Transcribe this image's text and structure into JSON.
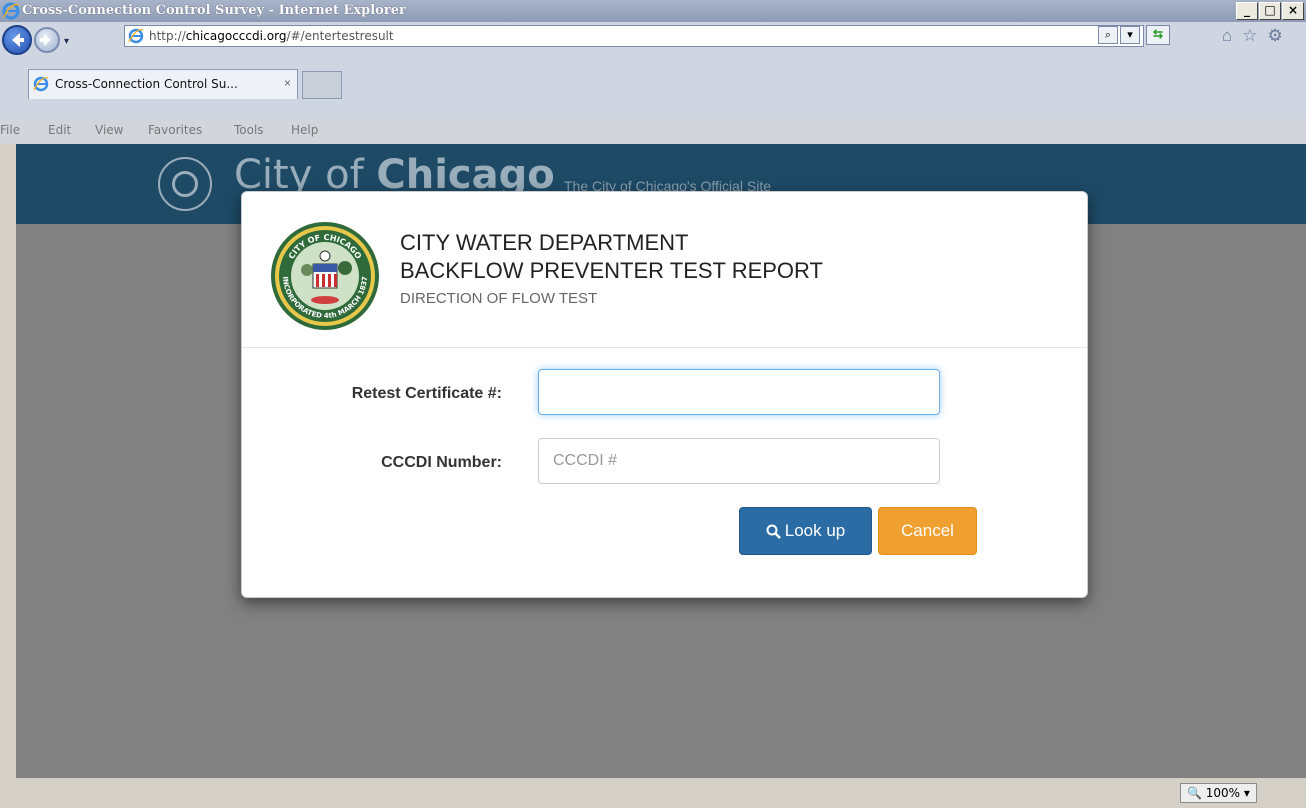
{
  "window": {
    "title": "Cross-Connection Control Survey - Internet Explorer",
    "minimize": "_",
    "maximize": "□",
    "close": "×"
  },
  "address_bar": {
    "url_prefix": "http://",
    "url_domain": "chicagocccdi.org",
    "url_path": "/#/entertestresult",
    "search_glyph": "⌕",
    "dropdown_glyph": "▾"
  },
  "tab": {
    "title": "Cross-Connection Control Su...",
    "close_glyph": "×"
  },
  "menu": [
    "File",
    "Edit",
    "View",
    "Favorites",
    "Tools",
    "Help"
  ],
  "page": {
    "city_prefix": "City of ",
    "city_name": "Chicago",
    "tagline": "The City of Chicago's Official Site"
  },
  "modal": {
    "title_line1": "CITY WATER DEPARTMENT",
    "title_line2": "BACKFLOW PREVENTER TEST REPORT",
    "subtitle": "DIRECTION OF FLOW TEST",
    "seal_top_text": "CITY OF CHICAGO",
    "seal_bottom_text": "INCORPORATED 4th MARCH 1837",
    "fields": {
      "retest_label": "Retest Certificate #:",
      "retest_value": "",
      "cccdi_label": "CCCDI Number:",
      "cccdi_placeholder": "CCCDI #"
    },
    "buttons": {
      "lookup": "Look up",
      "cancel": "Cancel"
    }
  },
  "status_bar": {
    "zoom": "100%"
  },
  "colors": {
    "header_band": "#1e4a66",
    "primary_button": "#2a6ca3",
    "warning_button": "#f0a030",
    "backdrop": "#818181"
  }
}
